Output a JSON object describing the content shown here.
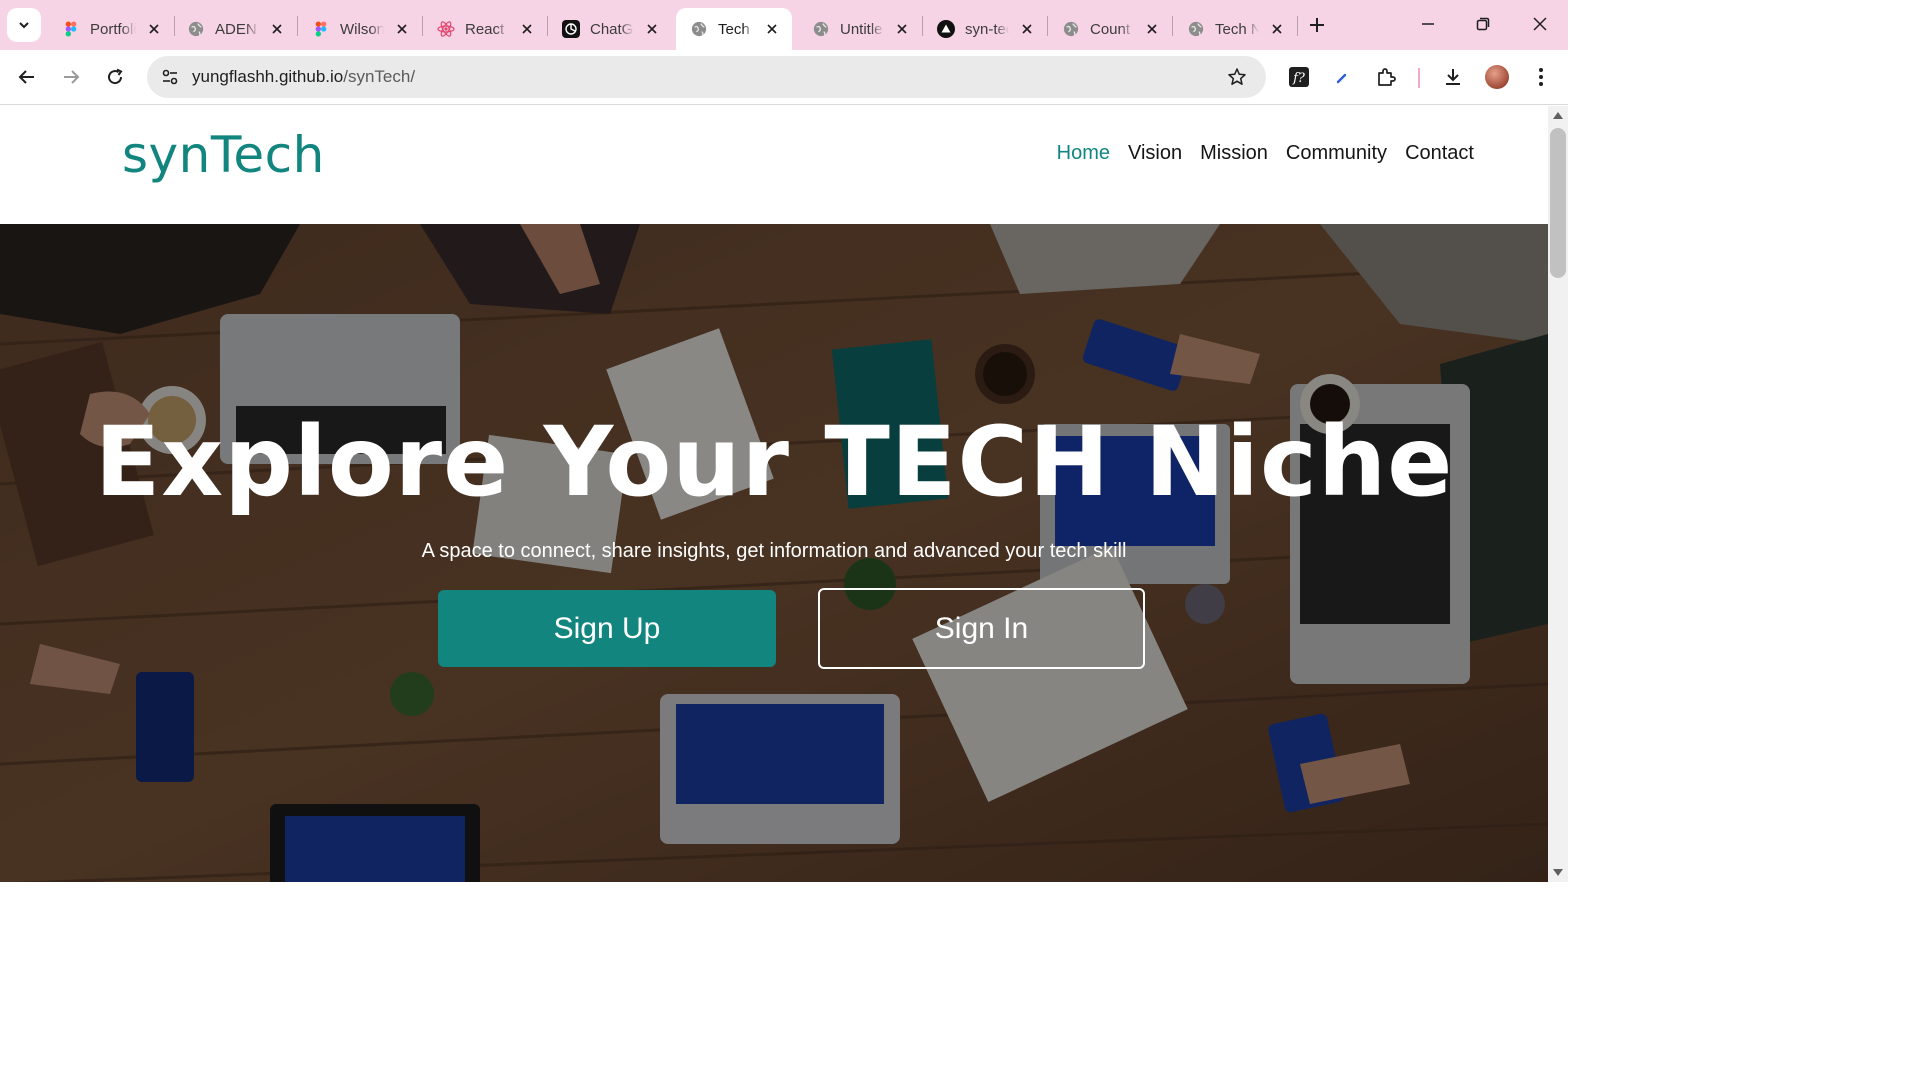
{
  "browser": {
    "tabs": [
      {
        "title": "Portfolio",
        "favicon": "figma-icon",
        "active": false
      },
      {
        "title": "ADEN",
        "favicon": "globe-icon",
        "active": false
      },
      {
        "title": "Wilson",
        "favicon": "figma-icon",
        "active": false
      },
      {
        "title": "React",
        "favicon": "react-icon",
        "active": false
      },
      {
        "title": "ChatGPT",
        "favicon": "chatgpt-icon",
        "active": false
      },
      {
        "title": "Tech N",
        "favicon": "globe-icon",
        "active": true
      },
      {
        "title": "Untitled",
        "favicon": "globe-icon",
        "active": false
      },
      {
        "title": "syn-tech",
        "favicon": "vercel-icon",
        "active": false
      },
      {
        "title": "Count",
        "favicon": "globe-icon",
        "active": false
      },
      {
        "title": "Tech N",
        "favicon": "globe-icon",
        "active": false
      }
    ],
    "url_host": "yungflashh.github.io",
    "url_path": "/synTech/"
  },
  "site": {
    "logo": "synTech",
    "nav": [
      "Home",
      "Vision",
      "Mission",
      "Community",
      "Contact"
    ],
    "active_nav": "Home",
    "hero": {
      "headline": "Explore Your TECH Niche",
      "subline": "A space to connect, share insights, get information and advanced your tech skill",
      "signup_label": "Sign Up",
      "signin_label": "Sign In"
    }
  },
  "colors": {
    "accent": "#12857f",
    "tabstrip": "#f7d3e6",
    "nav_text": "#151515"
  }
}
